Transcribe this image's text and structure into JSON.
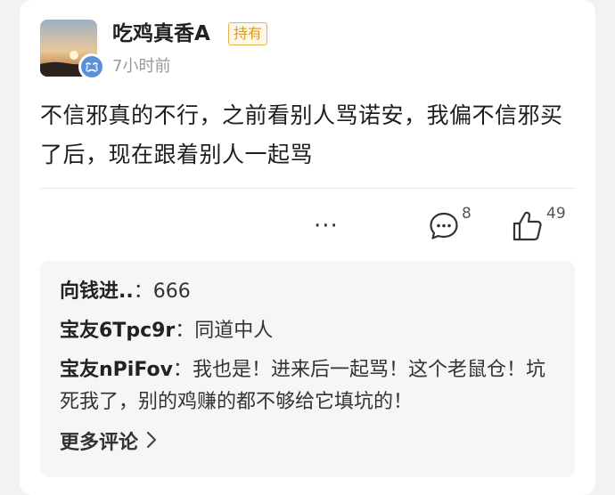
{
  "post": {
    "author": "吃鸡真香A",
    "holding_badge": "持有",
    "time": "7小时前",
    "body": "不信邪真的不行，之前看别人骂诺安，我偏不信邪买了后，现在跟着别人一起骂",
    "more_label": "···",
    "comment_count": "8",
    "like_count": "49"
  },
  "comments": [
    {
      "author": "向钱进..",
      "separator": "：",
      "text": "666"
    },
    {
      "author": "宝友6Tpc9r",
      "separator": "：",
      "text": "同道中人"
    },
    {
      "author": "宝友nPiFov",
      "separator": "：",
      "text": "我也是！进来后一起骂！这个老鼠仓！坑死我了，别的鸡赚的都不够给它填坑的！"
    }
  ],
  "more_comments_label": "更多评论",
  "colors": {
    "badge_border": "#e6b24d",
    "badge_text": "#d99a22",
    "comments_bg": "#f6f6f6",
    "avatar_badge": "#5b8fd8"
  },
  "icons": [
    "avatar",
    "crying-face-icon",
    "comment-icon",
    "thumbs-up-icon",
    "chevron-right-icon"
  ]
}
